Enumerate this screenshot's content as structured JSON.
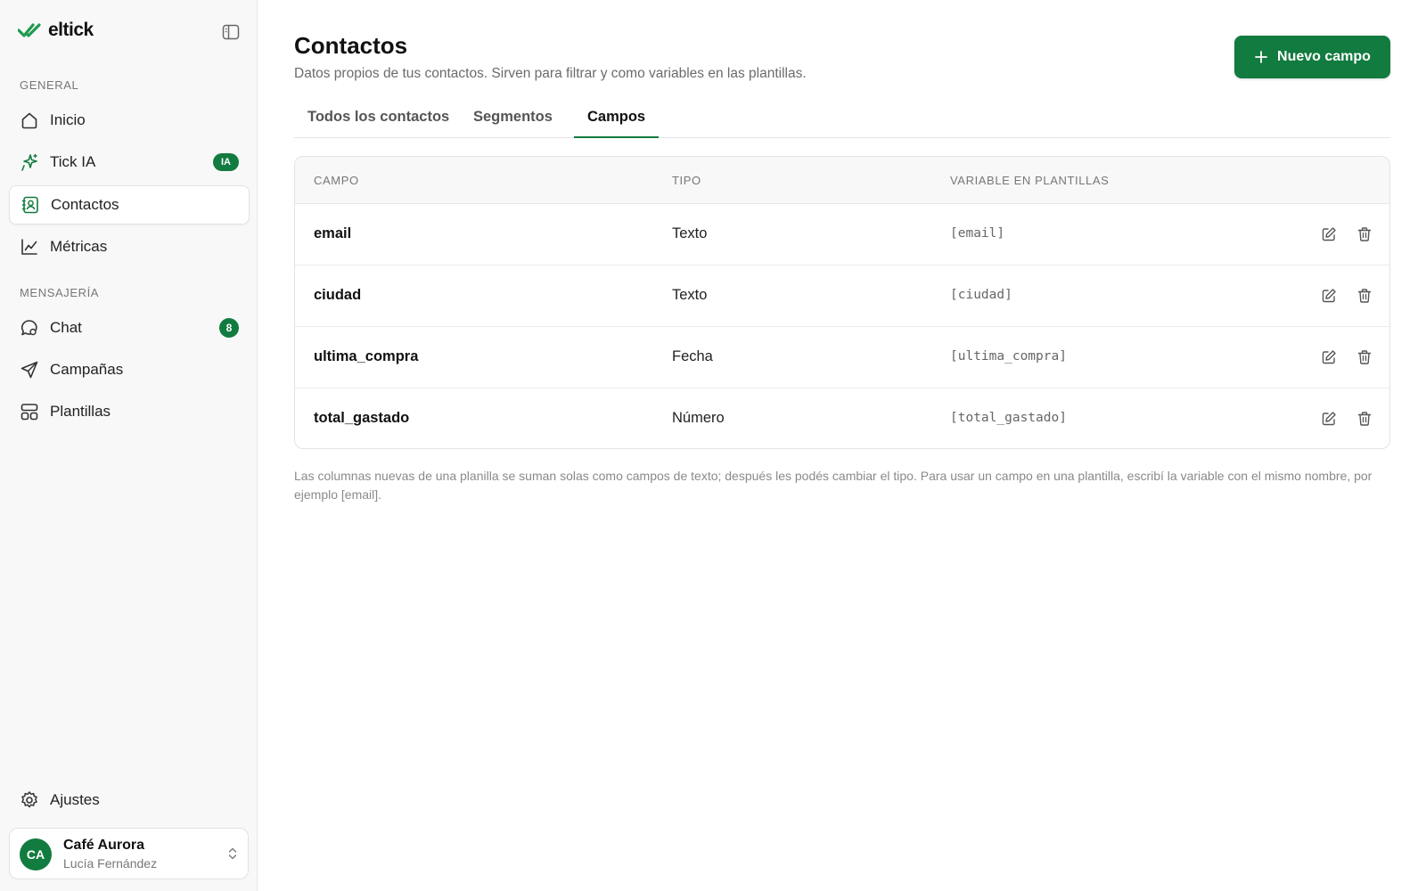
{
  "brand": {
    "name": "eltick"
  },
  "sidebar": {
    "sections": [
      {
        "label": "GENERAL"
      },
      {
        "label": "MENSAJERÍA"
      }
    ],
    "items": [
      {
        "label": "Inicio",
        "icon": "home-icon"
      },
      {
        "label": "Tick IA",
        "icon": "sparkle-icon",
        "badge": "IA"
      },
      {
        "label": "Contactos",
        "icon": "contacts-icon",
        "active": true
      },
      {
        "label": "Métricas",
        "icon": "chart-icon"
      },
      {
        "label": "Chat",
        "icon": "chat-icon",
        "badge": "8"
      },
      {
        "label": "Campañas",
        "icon": "send-icon"
      },
      {
        "label": "Plantillas",
        "icon": "templates-icon"
      }
    ],
    "settings_label": "Ajustes",
    "workspace": {
      "initials": "CA",
      "name": "Café Aurora",
      "user": "Lucía Fernández"
    }
  },
  "header": {
    "title": "Contactos",
    "subtitle": "Datos propios de tus contactos. Sirven para filtrar y como variables en las plantillas.",
    "primary_button": "Nuevo campo"
  },
  "tabs": [
    {
      "label": "Todos los contactos"
    },
    {
      "label": "Segmentos"
    },
    {
      "label": "Campos",
      "active": true
    }
  ],
  "table": {
    "columns": [
      "CAMPO",
      "TIPO",
      "VARIABLE EN PLANTILLAS"
    ],
    "rows": [
      {
        "name": "email",
        "type": "Texto",
        "variable": "[email]"
      },
      {
        "name": "ciudad",
        "type": "Texto",
        "variable": "[ciudad]"
      },
      {
        "name": "ultima_compra",
        "type": "Fecha",
        "variable": "[ultima_compra]"
      },
      {
        "name": "total_gastado",
        "type": "Número",
        "variable": "[total_gastado]"
      }
    ]
  },
  "footnote": "Las columnas nuevas de una planilla se suman solas como campos de texto; después les podés cambiar el tipo. Para usar un campo en una plantilla, escribí la variable con el mismo nombre, por ejemplo [email].",
  "colors": {
    "accent": "#127b3f",
    "sidebar_bg": "#f8f8f8",
    "muted_text": "#6b6b6b"
  }
}
